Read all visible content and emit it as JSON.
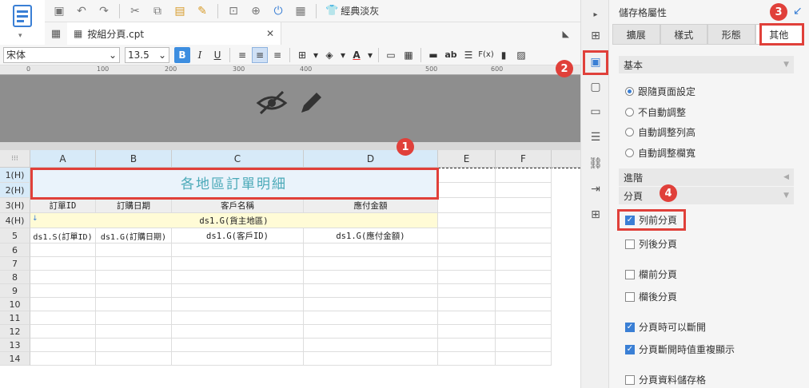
{
  "toolbar": {
    "theme_label": "經典淡灰"
  },
  "file_tab": {
    "name": "按組分頁.cpt"
  },
  "format": {
    "font": "宋体",
    "size": "13.5",
    "bold": "B",
    "italic": "I",
    "underline": "U",
    "fx": "F(x)",
    "ab": "ab"
  },
  "ruler": {
    "ticks": [
      "0",
      "100",
      "200",
      "300",
      "400",
      "500",
      "600"
    ]
  },
  "grid": {
    "columns": [
      "A",
      "B",
      "C",
      "D",
      "E",
      "F"
    ],
    "rows": [
      "1(H)",
      "2(H)",
      "3(H)",
      "4(H)",
      "5",
      "6",
      "7",
      "8",
      "9",
      "10",
      "11",
      "12",
      "13",
      "14"
    ],
    "title": "各地區訂單明細",
    "headers": [
      "訂單ID",
      "訂購日期",
      "客戶名稱",
      "應付金額"
    ],
    "group_row": "ds1.G(貨主地區)",
    "data_row": [
      "ds1.S(訂單ID)",
      "ds1.G(訂購日期)",
      "ds1.G(客戶ID)",
      "ds1.G(應付金額)"
    ]
  },
  "panel": {
    "title": "儲存格屬性",
    "tabs": [
      "擴展",
      "樣式",
      "形態",
      "其他"
    ],
    "section_basic": "基本",
    "radio_options": [
      "跟隨頁面設定",
      "不自動調整",
      "自動調整列高",
      "自動調整欄寬"
    ],
    "section_advanced": "進階",
    "section_paging": "分頁",
    "checkbox_options": [
      {
        "label": "列前分頁",
        "checked": true
      },
      {
        "label": "列後分頁",
        "checked": false
      },
      {
        "label": "欄前分頁",
        "checked": false
      },
      {
        "label": "欄後分頁",
        "checked": false
      },
      {
        "label": "分頁時可以斷開",
        "checked": true
      },
      {
        "label": "分頁斷開時值重複顯示",
        "checked": true
      },
      {
        "label": "分頁資料儲存格",
        "checked": false
      }
    ]
  },
  "badges": [
    "1",
    "2",
    "3",
    "4"
  ],
  "colors": {
    "accent": "#3a7fd5",
    "highlight": "#e0403a",
    "title_text": "#4aa9b8"
  }
}
